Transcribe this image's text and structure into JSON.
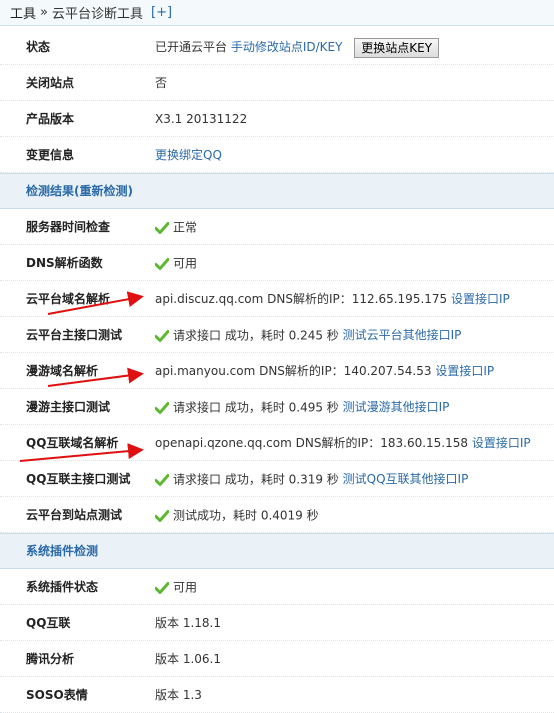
{
  "breadcrumb": {
    "root": "工具",
    "sep": "»",
    "current": "云平台诊断工具",
    "add": "[+]"
  },
  "rows": {
    "status": {
      "label": "状态",
      "text": "已开通云平台",
      "link": "手动修改站点ID/KEY",
      "button": "更换站点KEY"
    },
    "closed": {
      "label": "关闭站点",
      "value": "否"
    },
    "version": {
      "label": "产品版本",
      "value": "X3.1 20131122"
    },
    "change": {
      "label": "变更信息",
      "link": "更换绑定QQ"
    },
    "section1": {
      "title": "检测结果(重新检测)"
    },
    "servertime": {
      "label": "服务器时间检查",
      "value": "正常"
    },
    "dns": {
      "label": "DNS解析函数",
      "value": "可用"
    },
    "cloud_domain": {
      "label": "云平台域名解析",
      "value": "api.discuz.qq.com DNS解析的IP：112.65.195.175",
      "link": "设置接口IP"
    },
    "cloud_api": {
      "label": "云平台主接口测试",
      "value": "请求接口 成功，耗时 0.245 秒",
      "link": "测试云平台其他接口IP"
    },
    "manyou_domain": {
      "label": "漫游域名解析",
      "value": "api.manyou.com DNS解析的IP：140.207.54.53",
      "link": "设置接口IP"
    },
    "manyou_api": {
      "label": "漫游主接口测试",
      "value": "请求接口 成功，耗时 0.495 秒",
      "link": "测试漫游其他接口IP"
    },
    "qq_domain": {
      "label": "QQ互联域名解析",
      "value": "openapi.qzone.qq.com DNS解析的IP：183.60.15.158",
      "link": "设置接口IP"
    },
    "qq_api": {
      "label": "QQ互联主接口测试",
      "value": "请求接口 成功，耗时 0.319 秒",
      "link": "测试QQ互联其他接口IP"
    },
    "cloud_site": {
      "label": "云平台到站点测试",
      "value": "测试成功，耗时 0.4019 秒"
    },
    "section2": {
      "title": "系统插件检测"
    },
    "plugin_status": {
      "label": "系统插件状态",
      "value": "可用"
    },
    "qq_connect": {
      "label": "QQ互联",
      "value": "版本 1.18.1"
    },
    "tencent_analysis": {
      "label": "腾讯分析",
      "value": "版本 1.06.1"
    },
    "soso": {
      "label": "SOSO表情",
      "value": "版本 1.3"
    }
  },
  "colors": {
    "link": "#2b6aa8",
    "check": "#5cb82f",
    "arrow": "#e01010",
    "section_bg": "#eaf2f8"
  }
}
